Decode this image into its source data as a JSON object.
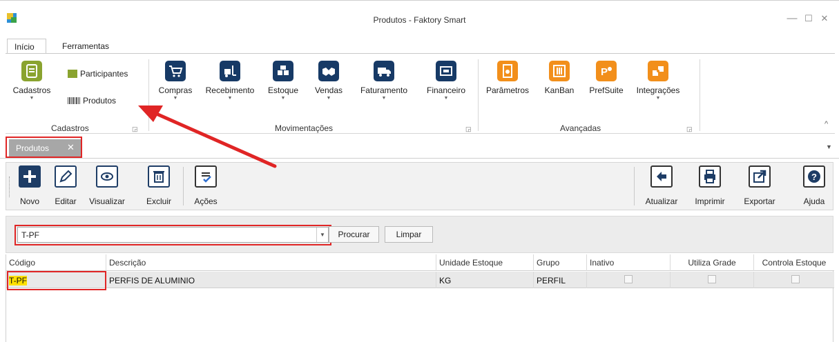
{
  "window": {
    "title": "Produtos - Faktory Smart",
    "minimize": "—",
    "maximize": "☐",
    "close": "✕"
  },
  "ribbon_tabs": [
    "Início",
    "Ferramentas"
  ],
  "ribbon": {
    "cadastros": {
      "label": "Cadastros",
      "participantes": "Participantes",
      "produtos": "Produtos",
      "group": "Cadastros"
    },
    "movimentacoes": {
      "group": "Movimentações",
      "items": [
        "Compras",
        "Recebimento",
        "Estoque",
        "Vendas",
        "Faturamento",
        "Financeiro"
      ]
    },
    "avancadas": {
      "group": "Avançadas",
      "items": [
        "Parâmetros",
        "KanBan",
        "PrefSuite",
        "Integrações"
      ]
    },
    "collapse": "^"
  },
  "doc_tab": {
    "label": "Produtos",
    "close": "✕",
    "overflow": "▼"
  },
  "toolbar": {
    "novo": "Novo",
    "editar": "Editar",
    "visualizar": "Visualizar",
    "excluir": "Excluir",
    "acoes": "Ações",
    "atualizar": "Atualizar",
    "imprimir": "Imprimir",
    "exportar": "Exportar",
    "ajuda": "Ajuda"
  },
  "search": {
    "value": "T-PF",
    "procurar": "Procurar",
    "limpar": "Limpar"
  },
  "grid": {
    "columns": [
      "Código",
      "Descrição",
      "Unidade Estoque",
      "Grupo",
      "Inativo",
      "Utiliza Grade",
      "Controla Estoque"
    ],
    "rows": [
      {
        "codigo": "T-PF",
        "descricao": "PERFIS DE ALUMINIO",
        "unidade": "KG",
        "grupo": "PERFIL",
        "inativo": false,
        "utiliza_grade": false,
        "controla_estoque": false
      }
    ]
  },
  "colors": {
    "highlight_red": "#e02525",
    "navy": "#1e3d66",
    "ribbon_orange": "#f28f1b",
    "ribbon_green": "#8aa32f",
    "search_highlight": "#ffe000"
  }
}
